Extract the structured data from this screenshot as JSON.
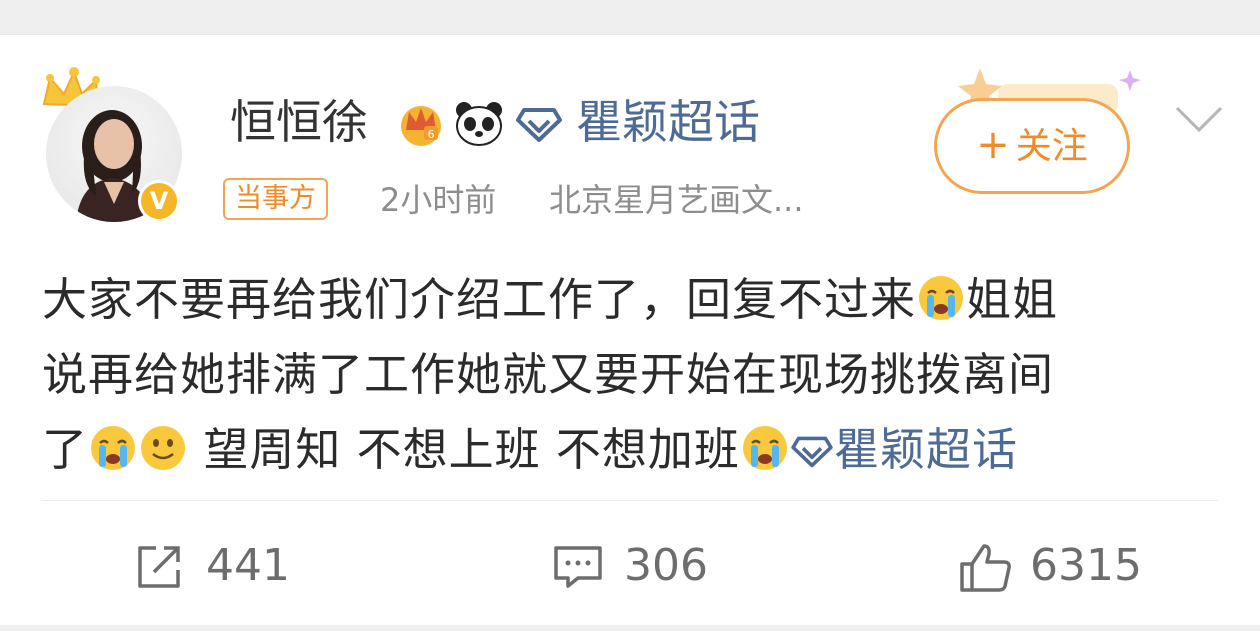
{
  "post": {
    "author": {
      "name": "恒恒徐",
      "role_badge": "当事方",
      "verified_mark": "V",
      "icons": [
        "crown-icon",
        "panda-icon",
        "diamond-icon"
      ],
      "supertopic": "瞿颖超话"
    },
    "meta": {
      "time": "2小时前",
      "source": "北京星月艺画文..."
    },
    "follow_label": "关注",
    "follow_plus": "+",
    "content": {
      "line1_text": "大家不要再给我们介绍工作了，回复不过来",
      "line1_tail": "姐姐",
      "line2_text": "说再给她排满了工作她就又要开始在现场挑拨离间",
      "line3_head": "了",
      "line3_text1": " 望周知 不想上班 不想加班",
      "topic_link": "瞿颖超话"
    },
    "actions": {
      "repost": "441",
      "comment": "306",
      "like": "6315"
    }
  },
  "colors": {
    "accent_orange": "#f08b28",
    "link_blue": "#4d6b95",
    "text_dark": "#2b2b2b",
    "text_gray": "#8d8d8d",
    "verified_gold": "#f5b728"
  }
}
